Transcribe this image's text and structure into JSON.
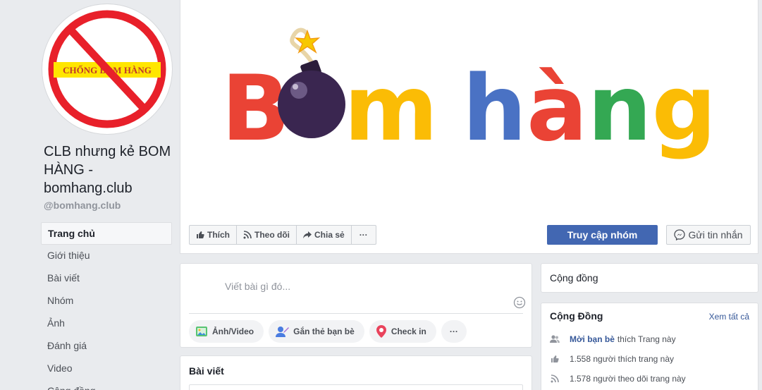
{
  "page": {
    "name": "CLB nhưng kẻ BOM HÀNG - bomhang.club",
    "handle": "@bomhang.club",
    "avatar_text": "CHỐNG BOM HÀNG"
  },
  "nav": [
    {
      "label": "Trang chủ",
      "active": true
    },
    {
      "label": "Giới thiệu"
    },
    {
      "label": "Bài viết"
    },
    {
      "label": "Nhóm"
    },
    {
      "label": "Ảnh"
    },
    {
      "label": "Đánh giá"
    },
    {
      "label": "Video"
    },
    {
      "label": "Cộng đồng"
    }
  ],
  "cover": {
    "word1_letter1": "B",
    "word1_rest": "m",
    "word2": "hàng"
  },
  "actions": {
    "like": "Thích",
    "follow": "Theo dõi",
    "share": "Chia sẻ",
    "more": "···",
    "primary": "Truy cập nhóm",
    "message": "Gửi tin nhắn"
  },
  "composer": {
    "placeholder": "Viết bài gì đó...",
    "photo": "Ảnh/Video",
    "tag": "Gắn thẻ bạn bè",
    "checkin": "Check in",
    "more": "···"
  },
  "posts": {
    "heading": "Bài viết"
  },
  "community_small": {
    "label": "Cộng đồng"
  },
  "community": {
    "title": "Cộng Đồng",
    "see_all": "Xem tất cả",
    "invite_link": "Mời bạn bè",
    "invite_text": "thích Trang này",
    "likes_text": "1.558 người thích trang này",
    "follows_text": "1.578 người theo dõi trang này"
  },
  "colors": {
    "red": "#ea4335",
    "yellow": "#fbbc05",
    "blue": "#4a72c4",
    "green": "#34a853",
    "accent": "#4267b2"
  },
  "icons": [
    "thumbs-up-icon",
    "rss-icon",
    "share-arrow-icon",
    "messenger-icon",
    "photo-icon",
    "tag-friend-icon",
    "location-pin-icon",
    "emoji-icon",
    "people-icon"
  ]
}
